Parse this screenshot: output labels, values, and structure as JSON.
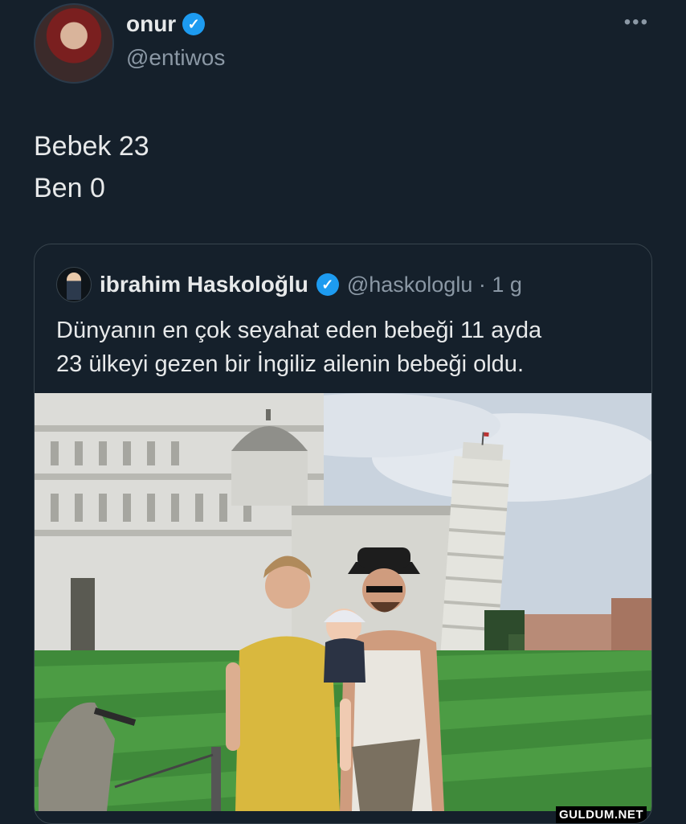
{
  "tweet": {
    "author_name": "onur",
    "author_handle": "@entiwos",
    "more_icon": "more-horizontal-icon",
    "text_lines": [
      "Bebek 23",
      "Ben 0"
    ]
  },
  "quoted": {
    "author_name": "ibrahim Haskoloğlu",
    "author_handle": "@haskologlu · 1 g",
    "text_lines": [
      "Dünyanın en çok seyahat eden bebeği 11 ayda",
      "23 ülkeyi gezen bir İngiliz ailenin bebeği oldu."
    ]
  },
  "watermark": "GULDUM.NET",
  "colors": {
    "background": "#15202b",
    "verified": "#1d9bf0",
    "muted_text": "#8b98a5",
    "border": "#38444d"
  }
}
